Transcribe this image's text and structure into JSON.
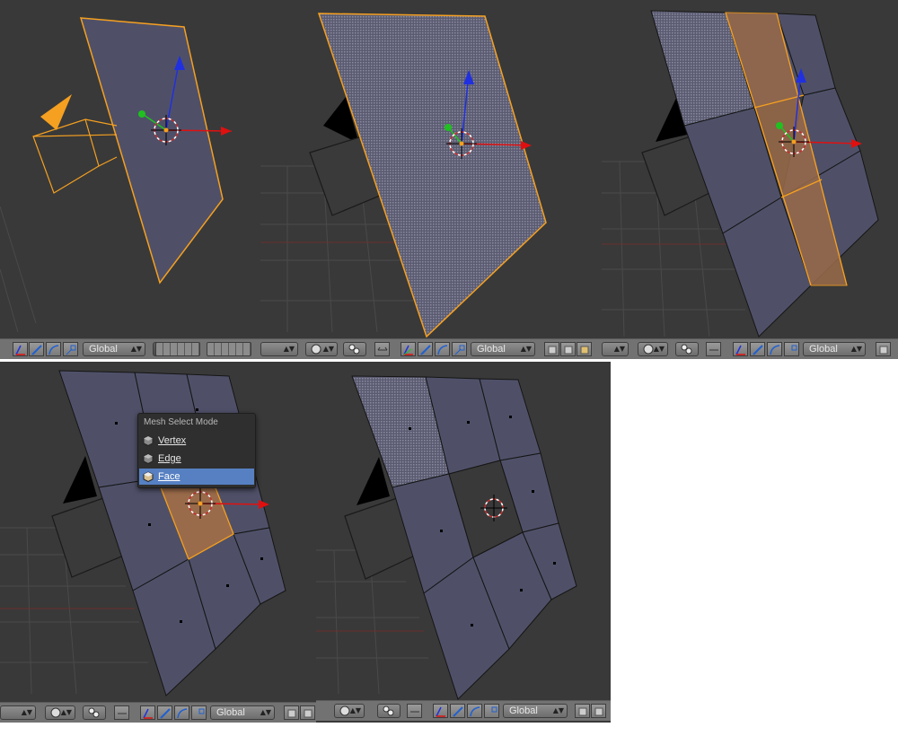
{
  "colors": {
    "viewport_bg": "#393939",
    "header_bg": "#727272",
    "selection_orange": "#f5a020",
    "mesh_face": "#4f5068",
    "x_axis": "#e01010",
    "y_axis": "#20c020",
    "z_axis": "#2030e0",
    "menu_highlight": "#5680c2"
  },
  "orientation_label": "Global",
  "mesh_select_menu": {
    "title": "Mesh Select Mode",
    "items": [
      {
        "label": "Vertex",
        "icon": "vertex-mode-icon",
        "selected": false
      },
      {
        "label": "Edge",
        "icon": "edge-mode-icon",
        "selected": false
      },
      {
        "label": "Face",
        "icon": "face-mode-icon",
        "selected": true
      }
    ]
  },
  "header_icons": [
    "view-shading-icon",
    "pivot-icon",
    "manipulator-icon",
    "translate-icon",
    "rotate-icon",
    "scale-icon",
    "layer-grid-icon",
    "select-mode-icons"
  ],
  "panels": [
    {
      "name": "object-mode-plane-selected"
    },
    {
      "name": "edit-mode-face-selected"
    },
    {
      "name": "edit-mode-subdivided-strip-selected"
    },
    {
      "name": "edit-mode-face-select-menu"
    },
    {
      "name": "edit-mode-face-deleted"
    }
  ]
}
